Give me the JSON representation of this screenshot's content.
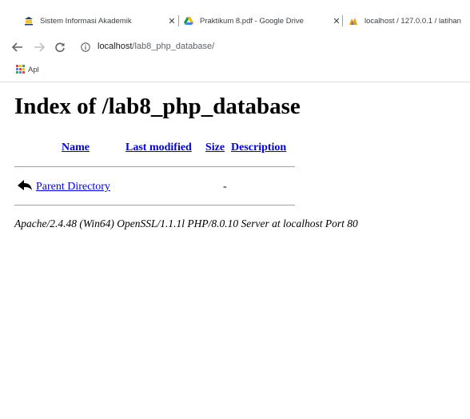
{
  "tabs": [
    {
      "title": "Sistem Informasi Akademik",
      "icon": "university-logo-icon",
      "close": "✕"
    },
    {
      "title": "Praktikum 8.pdf - Google Drive",
      "icon": "google-drive-icon",
      "close": "✕"
    },
    {
      "title": "localhost / 127.0.0.1 / latihan",
      "icon": "phpmyadmin-icon"
    }
  ],
  "address_bar": {
    "host": "localhost",
    "path": "/lab8_php_database/"
  },
  "bookmarks_bar": {
    "apps_label": "Apl"
  },
  "page": {
    "heading": "Index of /lab8_php_database",
    "columns": [
      "Name",
      "Last modified",
      "Size",
      "Description"
    ],
    "rows": [
      {
        "name": "Parent Directory",
        "icon": "back-arrow-icon",
        "last_modified": "",
        "size": "-",
        "description": ""
      }
    ],
    "server_signature": "Apache/2.4.48 (Win64) OpenSSL/1.1.1l PHP/8.0.10 Server at localhost Port 80"
  },
  "colors": {
    "link": "#0000ee",
    "tab_text": "#3c4043",
    "url_path": "#5f6368"
  }
}
